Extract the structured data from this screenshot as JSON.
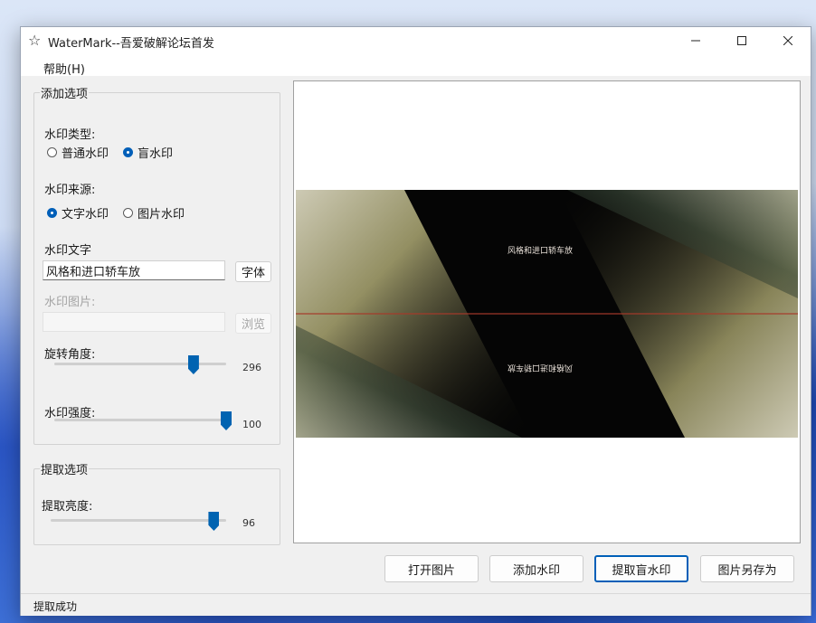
{
  "window": {
    "title": "WaterMark--吾爱破解论坛首发"
  },
  "menu": {
    "help": "帮助(H)"
  },
  "add_group": {
    "legend": "添加选项",
    "type_label": "水印类型:",
    "type_options": [
      "普通水印",
      "盲水印"
    ],
    "type_selected": 1,
    "source_label": "水印来源:",
    "source_options": [
      "文字水印",
      "图片水印"
    ],
    "source_selected": 0,
    "text_label": "水印文字",
    "text_value": "风格和进口轿车放",
    "font_button": "字体",
    "image_label": "水印图片:",
    "image_value": "",
    "browse_button": "浏览",
    "rotation_label": "旋转角度:",
    "rotation_value": "296",
    "rotation_fraction": 0.81,
    "strength_label": "水印强度:",
    "strength_value": "100",
    "strength_fraction": 1.0
  },
  "extract_group": {
    "legend": "提取选项",
    "brightness_label": "提取亮度:",
    "brightness_value": "96",
    "brightness_fraction": 0.93
  },
  "preview": {
    "watermark_text": "风格和进口轿车放",
    "watermark_text_mirrored": "风格和进口轿车放"
  },
  "buttons": {
    "open": "打开图片",
    "add": "添加水印",
    "extract": "提取盲水印",
    "save_as": "图片另存为"
  },
  "status": {
    "text": "提取成功"
  },
  "colors": {
    "accent": "#005fb8",
    "window_bg": "#f0f0f0"
  }
}
